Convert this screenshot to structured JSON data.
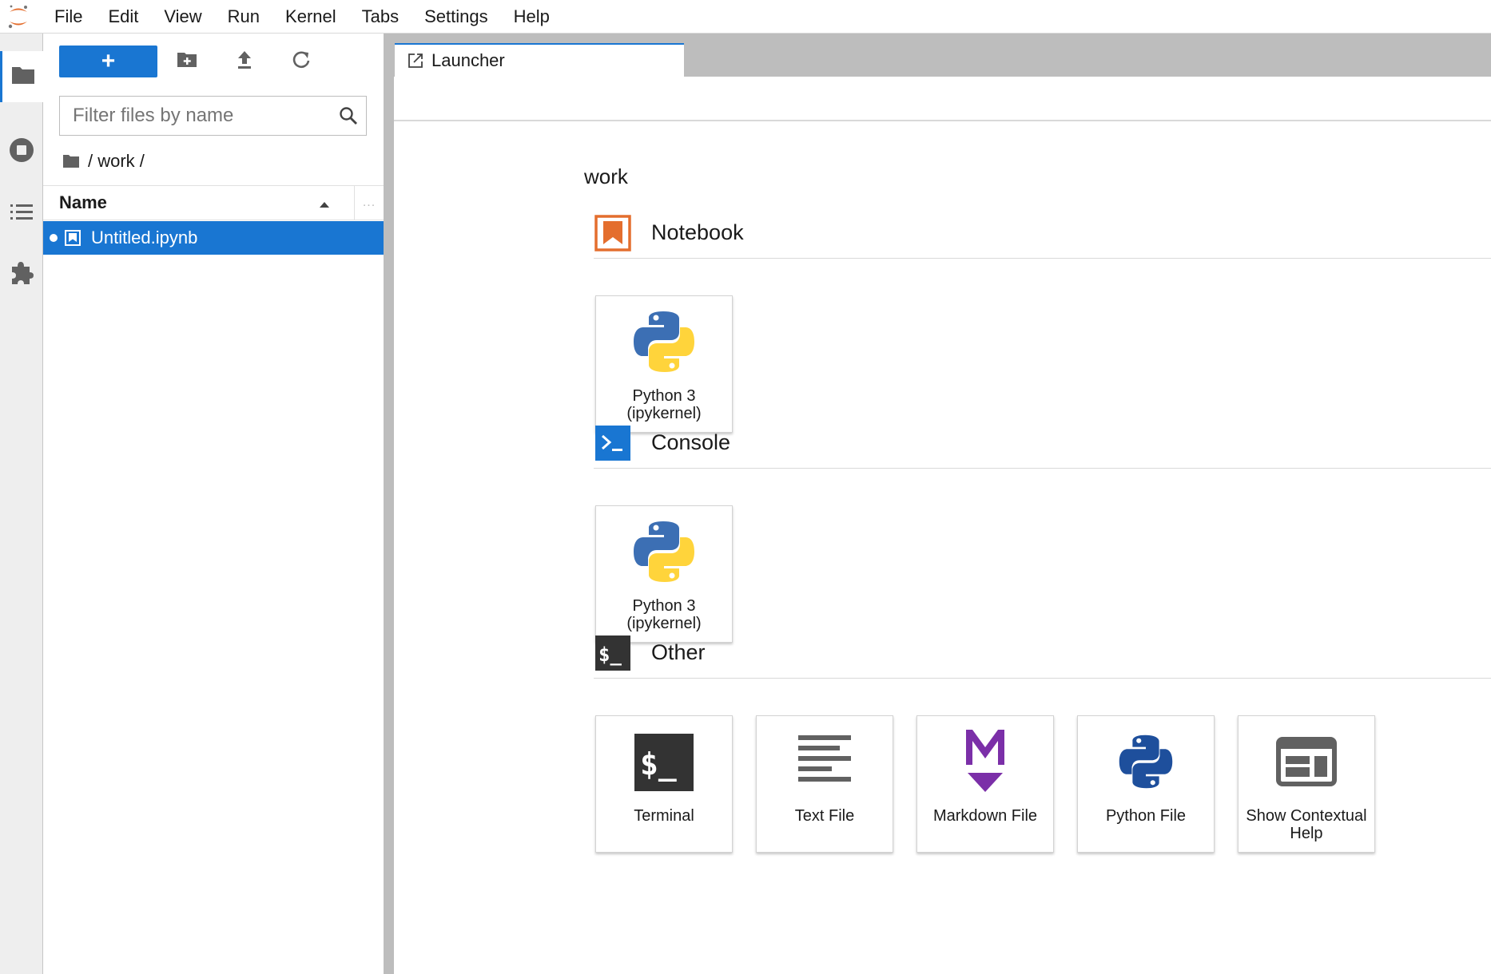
{
  "menubar": {
    "items": [
      "File",
      "Edit",
      "View",
      "Run",
      "Kernel",
      "Tabs",
      "Settings",
      "Help"
    ]
  },
  "sidebar": {
    "items": [
      {
        "icon": "folder-icon",
        "active": true
      },
      {
        "icon": "running-stop-icon",
        "active": false
      },
      {
        "icon": "table-of-contents-icon",
        "active": false
      },
      {
        "icon": "extension-puzzle-icon",
        "active": false
      }
    ]
  },
  "filebrowser": {
    "new_button_label": "+",
    "filter_placeholder": "Filter files by name",
    "breadcrumb": "/ work /",
    "column_name": "Name",
    "column_more": "...",
    "files": [
      {
        "name": "Untitled.ipynb",
        "running": true,
        "selected": true
      }
    ]
  },
  "tabs": [
    {
      "label": "Launcher",
      "active": true
    }
  ],
  "launcher": {
    "cwd": "work",
    "sections": [
      {
        "title": "Notebook",
        "icon": "notebook-icon",
        "items": [
          {
            "label": "Python 3 (ipykernel)",
            "icon": "python-logo-icon"
          }
        ]
      },
      {
        "title": "Console",
        "icon": "console-icon",
        "items": [
          {
            "label": "Python 3 (ipykernel)",
            "icon": "python-logo-icon"
          }
        ]
      },
      {
        "title": "Other",
        "icon": "terminal-icon",
        "items": [
          {
            "label": "Terminal",
            "icon": "terminal-icon"
          },
          {
            "label": "Text File",
            "icon": "text-file-icon"
          },
          {
            "label": "Markdown File",
            "icon": "markdown-icon"
          },
          {
            "label": "Python File",
            "icon": "python-file-icon"
          },
          {
            "label": "Show Contextual Help",
            "icon": "contextual-help-icon"
          }
        ]
      }
    ]
  },
  "colors": {
    "accent": "#1976d2",
    "notebook_orange": "#e46e2e",
    "markdown_purple": "#7b2fa8",
    "python_blue": "#3c6fb4",
    "python_yellow": "#ffd43b"
  }
}
